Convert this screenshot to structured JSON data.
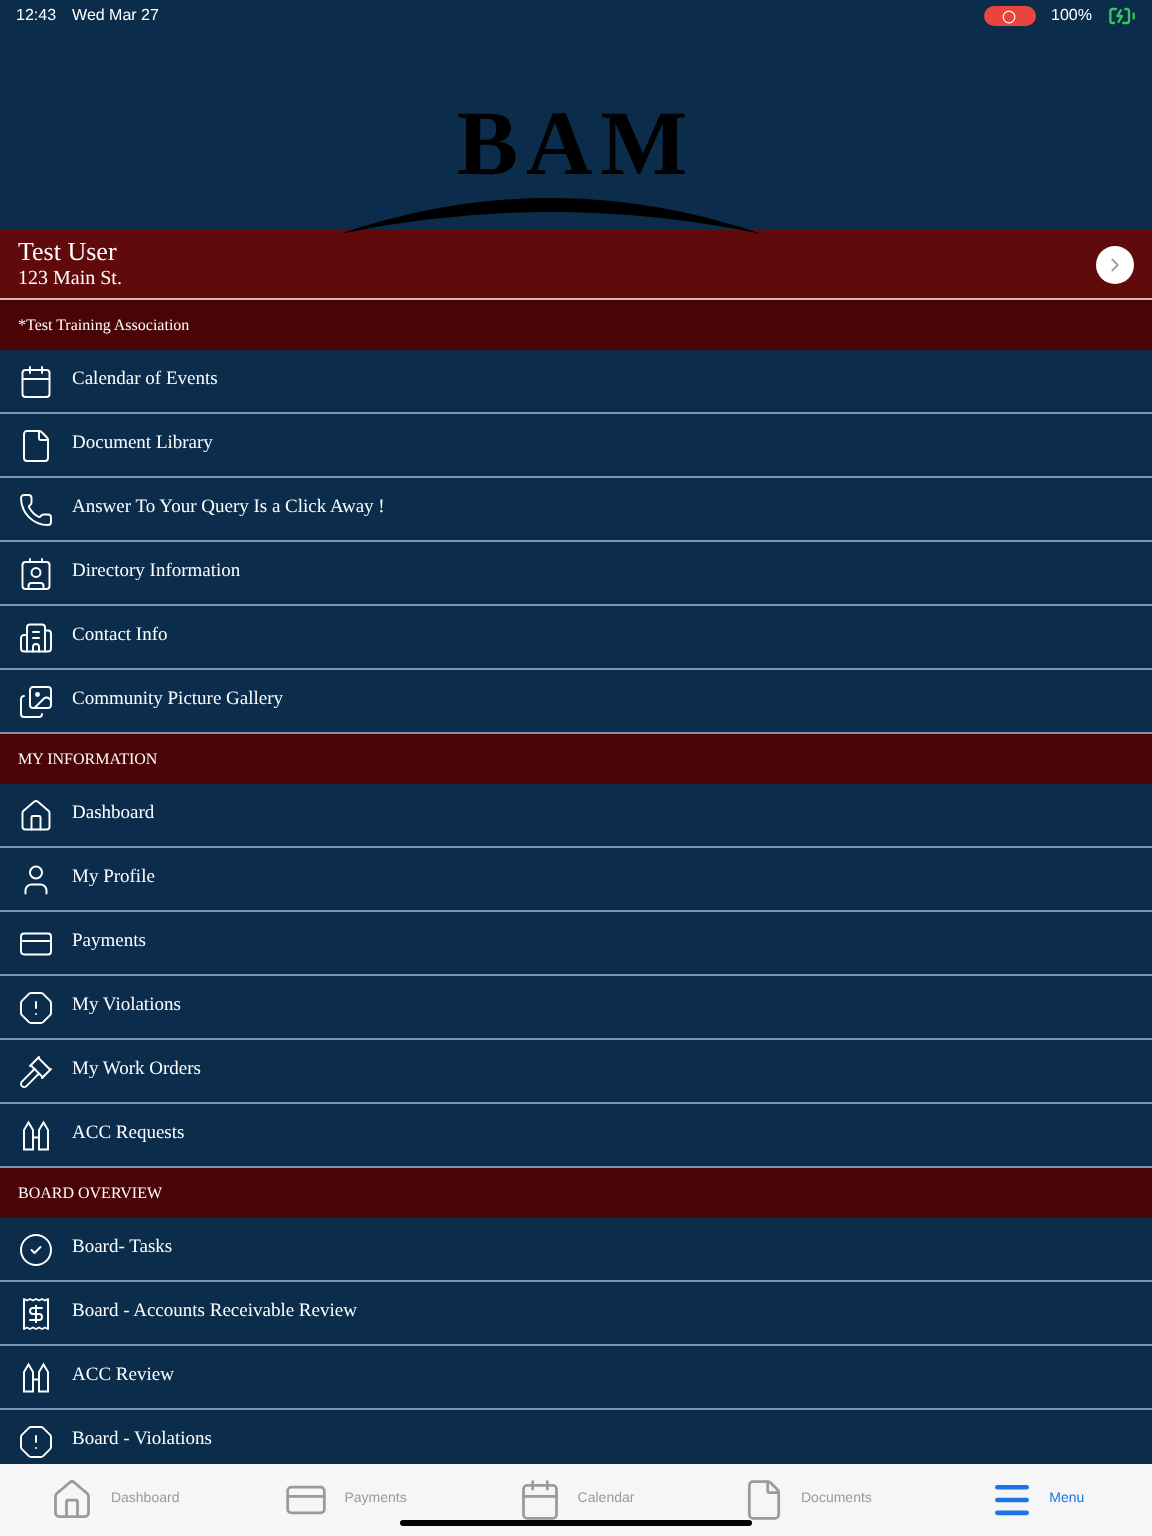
{
  "status_bar": {
    "time": "12:43",
    "date": "Wed Mar 27",
    "battery": "100%"
  },
  "logo": "BAM",
  "user": {
    "name": "Test User",
    "address": "123 Main St."
  },
  "sections": [
    {
      "title": "*Test Training Association",
      "items": [
        "Calendar of Events",
        "Document Library",
        "Answer To Your Query Is a Click Away !",
        "Directory Information",
        "Contact Info",
        "Community Picture Gallery"
      ]
    },
    {
      "title": "MY INFORMATION",
      "items": [
        "Dashboard",
        "My Profile",
        "Payments",
        "My Violations",
        "My Work Orders",
        "ACC Requests"
      ]
    },
    {
      "title": "BOARD OVERVIEW",
      "items": [
        "Board- Tasks",
        "Board - Accounts Receivable Review",
        "ACC Review",
        "Board - Violations"
      ]
    }
  ],
  "tab_bar": [
    {
      "label": "Dashboard",
      "selected": false
    },
    {
      "label": "Payments",
      "selected": false
    },
    {
      "label": "Calendar",
      "selected": false
    },
    {
      "label": "Documents",
      "selected": false
    },
    {
      "label": "Menu",
      "selected": true
    }
  ]
}
